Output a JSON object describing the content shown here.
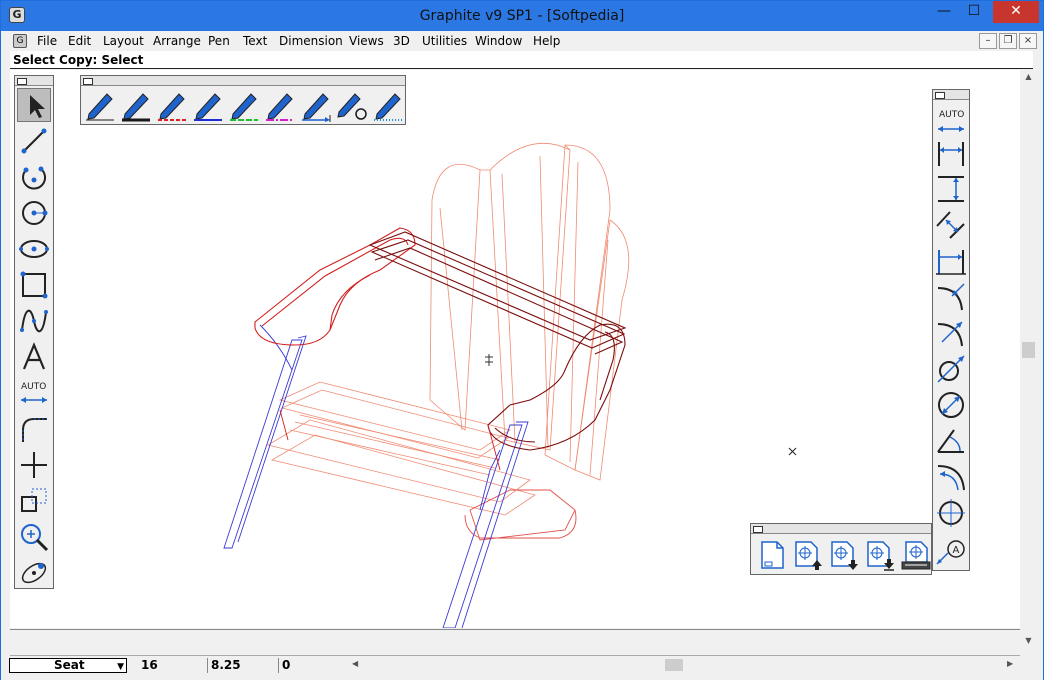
{
  "window": {
    "title": "Graphite v9 SP1 - [Softpedia]",
    "app_icon": "graphite-app-icon",
    "minimize_glyph": "—",
    "maximize_glyph": "☐",
    "close_glyph": "✕"
  },
  "menubar": {
    "doc_icon": "graphite-document-icon",
    "items": [
      "File",
      "Edit",
      "Layout",
      "Arrange",
      "Pen",
      "Text",
      "Dimension",
      "Views",
      "3D",
      "Utilities",
      "Window",
      "Help"
    ],
    "mdi_minimize": "–",
    "mdi_restore": "❐",
    "mdi_close": "×"
  },
  "status": {
    "prompt": "Select Copy: Select"
  },
  "left_toolbar": {
    "tools": [
      {
        "name": "select-arrow-icon",
        "selected": true
      },
      {
        "name": "line-tool-icon"
      },
      {
        "name": "arc-tool-icon"
      },
      {
        "name": "circle-tool-icon"
      },
      {
        "name": "ellipse-tool-icon"
      },
      {
        "name": "rectangle-tool-icon"
      },
      {
        "name": "spline-tool-icon"
      },
      {
        "name": "text-tool-icon"
      },
      {
        "name": "auto-dimension-icon"
      },
      {
        "name": "fillet-tool-icon"
      },
      {
        "name": "trim-tool-icon"
      },
      {
        "name": "copy-transform-icon"
      },
      {
        "name": "zoom-tool-icon"
      },
      {
        "name": "navigate-3d-icon"
      }
    ],
    "auto_label": "AUTO"
  },
  "pen_toolbar": {
    "pens": [
      {
        "name": "pen-thin-icon",
        "color": "#1a1a1a"
      },
      {
        "name": "pen-thick-icon",
        "color": "#1a1a1a"
      },
      {
        "name": "pen-red-dashed-icon",
        "color": "#e02020"
      },
      {
        "name": "pen-blue-icon",
        "color": "#1c2fd6"
      },
      {
        "name": "pen-green-dashed-icon",
        "color": "#1fbf2f"
      },
      {
        "name": "pen-magenta-dashed-icon",
        "color": "#d420c8"
      },
      {
        "name": "pen-arrow-icon",
        "color": "#1a5fd0"
      },
      {
        "name": "pen-marker-icon",
        "color": "#1a1a1a"
      },
      {
        "name": "pen-dotted-icon",
        "color": "#1a8fd0"
      }
    ]
  },
  "dimension_toolbar": {
    "auto_label": "AUTO",
    "tools": [
      "horizontal-dimension-icon",
      "vertical-dimension-icon",
      "aligned-dimension-icon",
      "baseline-dimension-icon",
      "radius-dimension-icon",
      "arc-length-dimension-icon",
      "diameter-dimension-icon",
      "diameter-circle-dimension-icon",
      "angular-dimension-icon",
      "arc-angle-dimension-icon",
      "center-mark-icon",
      "leader-note-icon"
    ]
  },
  "views_toolbar": {
    "tools": [
      "new-view-icon",
      "view-move-up-icon",
      "view-move-down-icon",
      "view-move-bottom-icon",
      "view-print-icon"
    ]
  },
  "bottom": {
    "layer": "Seat",
    "x": "16",
    "y": "8.25",
    "z": "0"
  },
  "colors": {
    "accent_blue": "#2b78e4",
    "tool_blue": "#1f63cc",
    "drawing_red": "#d21f1f",
    "drawing_dark_red": "#7a0d0d",
    "drawing_salmon": "#f08a72",
    "drawing_blue": "#3a3ad6"
  }
}
